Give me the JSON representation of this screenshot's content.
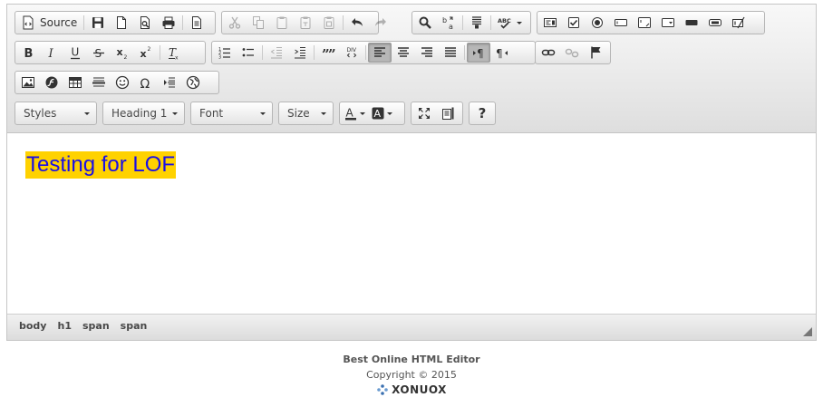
{
  "toolbar": {
    "source_label": "Source",
    "styles_label": "Styles",
    "format_label": "Heading 1",
    "font_label": "Font",
    "size_label": "Size",
    "help_label": "?",
    "icons": [
      "source-icon",
      "save-icon",
      "new-page-icon",
      "preview-icon",
      "print-icon",
      "templates-icon",
      "cut-icon",
      "copy-icon",
      "paste-icon",
      "paste-text-icon",
      "paste-word-icon",
      "undo-icon",
      "redo-icon",
      "find-icon",
      "replace-icon",
      "select-all-icon",
      "spellcheck-icon",
      "form-icon",
      "checkbox-icon",
      "radio-icon",
      "textfield-icon",
      "textarea-icon",
      "select-icon",
      "button-icon",
      "image-button-icon",
      "hidden-field-icon",
      "bold-icon",
      "italic-icon",
      "underline-icon",
      "strike-icon",
      "subscript-icon",
      "superscript-icon",
      "remove-format-icon",
      "numbered-list-icon",
      "bulleted-list-icon",
      "outdent-icon",
      "indent-icon",
      "blockquote-icon",
      "div-icon",
      "align-left-icon",
      "align-center-icon",
      "align-right-icon",
      "justify-icon",
      "ltr-icon",
      "rtl-icon",
      "link-icon",
      "unlink-icon",
      "anchor-icon",
      "image-icon",
      "flash-icon",
      "table-icon",
      "horizontal-rule-icon",
      "smiley-icon",
      "special-char-icon",
      "page-break-icon",
      "iframe-icon",
      "text-color-icon",
      "bg-color-icon",
      "maximize-icon",
      "show-blocks-icon"
    ]
  },
  "content": {
    "heading_text": "Testing for LOF",
    "text_color": "#1a0fe6",
    "highlight_color": "#ffd200"
  },
  "statusbar": {
    "path": [
      "body",
      "h1",
      "span",
      "span"
    ]
  },
  "footer": {
    "title": "Best Online HTML Editor",
    "copyright": "Copyright © 2015",
    "logo_text": "XONUOX"
  }
}
